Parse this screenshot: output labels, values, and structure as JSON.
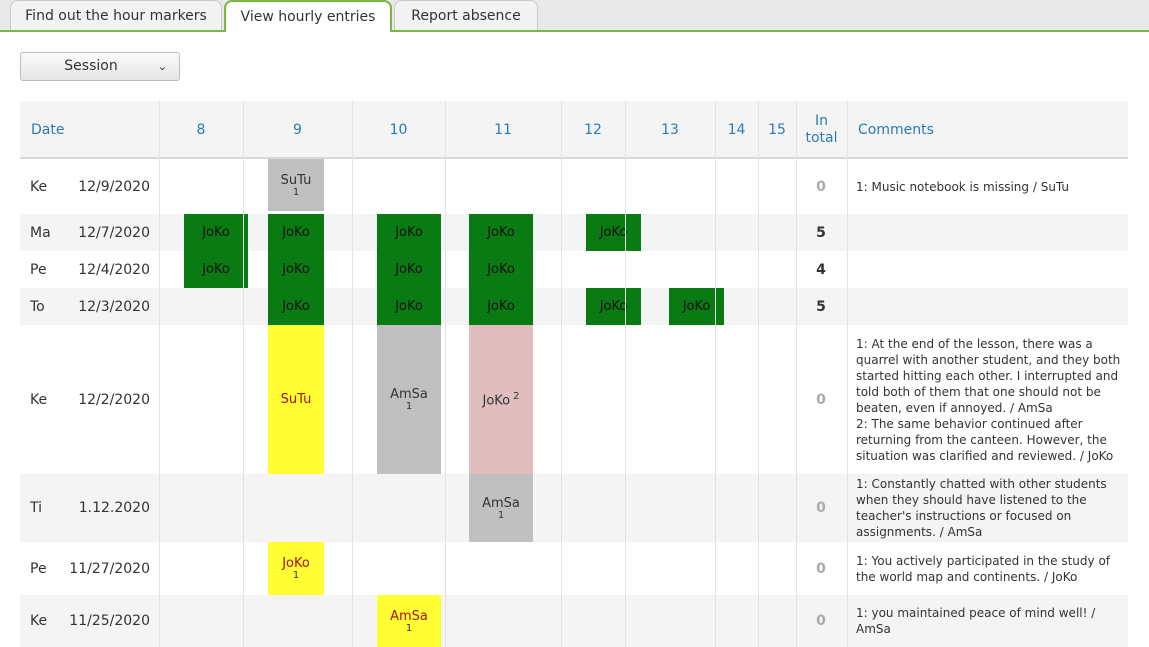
{
  "tabs": [
    {
      "label": "Find out the hour markers",
      "active": false
    },
    {
      "label": "View hourly entries",
      "active": true
    },
    {
      "label": "Report absence",
      "active": false
    }
  ],
  "session": {
    "label": "Session",
    "icon": "chevron-down-icon"
  },
  "columns": {
    "date": "Date",
    "hours": [
      "8",
      "9",
      "10",
      "11",
      "12",
      "13",
      "14",
      "15"
    ],
    "total_line1": "In",
    "total_line2": "total",
    "comments": "Comments"
  },
  "rows": [
    {
      "day": "Ke",
      "date": "12/9/2020",
      "total": "0",
      "entries": [
        {
          "hour": "9",
          "name": "SuTu",
          "sub": "1",
          "color": "gray"
        }
      ],
      "comment": "1: Music notebook is missing / SuTu"
    },
    {
      "day": "Ma",
      "date": "12/7/2020",
      "total": "5",
      "entries": [
        {
          "hour": "8",
          "name": "JoKo",
          "color": "green"
        },
        {
          "hour": "9",
          "name": "JoKo",
          "color": "green"
        },
        {
          "hour": "10",
          "name": "JoKo",
          "color": "green"
        },
        {
          "hour": "11",
          "name": "JoKo",
          "color": "green"
        },
        {
          "hour": "12",
          "name": "JoKo",
          "color": "green"
        }
      ],
      "comment": ""
    },
    {
      "day": "Pe",
      "date": "12/4/2020",
      "total": "4",
      "entries": [
        {
          "hour": "8",
          "name": "JoKo",
          "color": "green"
        },
        {
          "hour": "9",
          "name": "JoKo",
          "color": "green"
        },
        {
          "hour": "10",
          "name": "JoKo",
          "color": "green"
        },
        {
          "hour": "11",
          "name": "JoKo",
          "color": "green"
        }
      ],
      "comment": ""
    },
    {
      "day": "To",
      "date": "12/3/2020",
      "total": "5",
      "entries": [
        {
          "hour": "9",
          "name": "JoKo",
          "color": "green"
        },
        {
          "hour": "10",
          "name": "JoKo",
          "color": "green"
        },
        {
          "hour": "11",
          "name": "JoKo",
          "color": "green"
        },
        {
          "hour": "12",
          "name": "JoKo",
          "color": "green"
        },
        {
          "hour": "13",
          "name": "JoKo",
          "color": "green"
        }
      ],
      "comment": ""
    },
    {
      "day": "Ke",
      "date": "12/2/2020",
      "total": "0",
      "entries": [
        {
          "hour": "9",
          "name": "SuTu",
          "color": "yellow"
        },
        {
          "hour": "10",
          "name": "AmSa",
          "sub": "1",
          "color": "gray"
        },
        {
          "hour": "11",
          "name": "JoKo",
          "sup": "2",
          "color": "pink"
        }
      ],
      "comment": "1: At the end of the lesson, there was a quarrel with another student, and they both started hitting each other. I interrupted and told both of them that one should not be beaten, even if annoyed. / AmSa\n2: The same behavior continued after returning from the canteen. However, the situation was clarified and reviewed. / JoKo"
    },
    {
      "day": "Ti",
      "date": "1.12.2020",
      "total": "0",
      "entries": [
        {
          "hour": "11",
          "name": "AmSa",
          "sub": "1",
          "color": "gray"
        }
      ],
      "comment": "1: Constantly chatted with other students when they should have listened to the teacher's instructions or focused on assignments. / AmSa"
    },
    {
      "day": "Pe",
      "date": "11/27/2020",
      "total": "0",
      "entries": [
        {
          "hour": "9",
          "name": "JoKo",
          "sub": "1",
          "color": "yellow"
        }
      ],
      "comment": "1: You actively participated in the study of the world map and continents. / JoKo"
    },
    {
      "day": "Ke",
      "date": "11/25/2020",
      "total": "0",
      "entries": [
        {
          "hour": "10",
          "name": "AmSa",
          "sub": "1",
          "color": "yellow"
        }
      ],
      "comment": "1: you maintained peace of mind well! / AmSa"
    }
  ]
}
